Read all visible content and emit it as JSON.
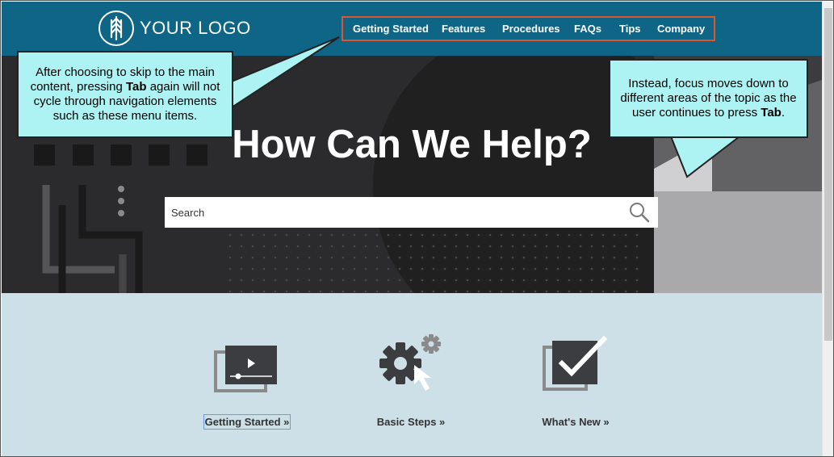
{
  "header": {
    "logo_text": "YOUR LOGO",
    "nav": [
      {
        "label": "Getting Started"
      },
      {
        "label": "Features"
      },
      {
        "label": "Procedures"
      },
      {
        "label": "FAQs"
      },
      {
        "label": "Tips"
      },
      {
        "label": "Company"
      }
    ]
  },
  "hero": {
    "title": "How Can We Help?",
    "search_placeholder": "Search"
  },
  "tiles": [
    {
      "label": "Getting Started »",
      "icon": "video-play-icon",
      "focused": true
    },
    {
      "label": "Basic Steps »",
      "icon": "gear-cursor-icon",
      "focused": false
    },
    {
      "label": "What's New »",
      "icon": "checkbox-check-icon",
      "focused": false
    }
  ],
  "callouts": {
    "left": {
      "before": "After choosing to skip to the main content, pressing ",
      "key": "Tab",
      "after": " again will not cycle through navigation elements such as these menu items."
    },
    "right": {
      "before": "Instead, focus moves down to different areas of the topic as the user continues to press ",
      "key": "Tab",
      "after": "."
    }
  },
  "colors": {
    "header_bg": "#0e6585",
    "hero_bg": "#2b2b2d",
    "lower_bg": "#cde0e7",
    "callout_bg": "#aef3f3",
    "nav_highlight": "#e0552f",
    "focus_outline": "#6a9ce4"
  }
}
